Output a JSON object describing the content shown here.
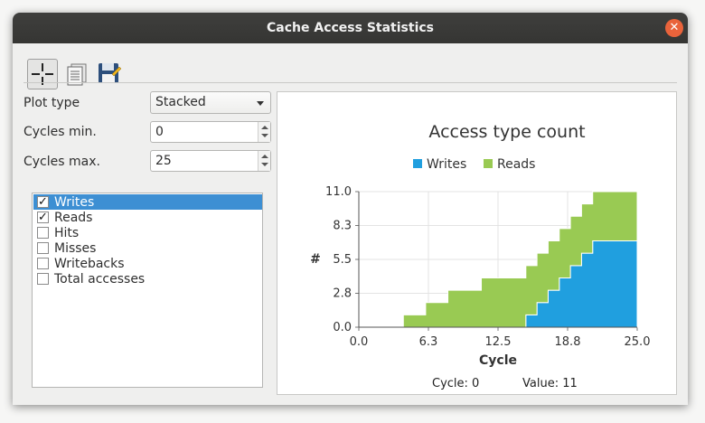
{
  "window": {
    "title": "Cache Access Statistics"
  },
  "toolbar": {
    "buttons": [
      {
        "icon": "crosshair-icon"
      },
      {
        "icon": "document-list-icon"
      },
      {
        "icon": "save-disk-icon"
      }
    ]
  },
  "form": {
    "plot_type_label": "Plot type",
    "plot_type_value": "Stacked",
    "cycles_min_label": "Cycles min.",
    "cycles_min_value": "0",
    "cycles_max_label": "Cycles max.",
    "cycles_max_value": "25"
  },
  "series_list": [
    {
      "label": "Writes",
      "checked": true,
      "selected": true
    },
    {
      "label": "Reads",
      "checked": true,
      "selected": false
    },
    {
      "label": "Hits",
      "checked": false,
      "selected": false
    },
    {
      "label": "Misses",
      "checked": false,
      "selected": false
    },
    {
      "label": "Writebacks",
      "checked": false,
      "selected": false
    },
    {
      "label": "Total accesses",
      "checked": false,
      "selected": false
    }
  ],
  "status": {
    "cycle": "Cycle: 0",
    "value": "Value: 11"
  },
  "colors": {
    "writes": "#209fdf",
    "reads": "#99ca53",
    "selection": "#3d8fd3"
  },
  "chart_data": {
    "type": "area",
    "title": "Access type count",
    "xlabel": "Cycle",
    "ylabel": "#",
    "xlim": [
      0,
      25
    ],
    "ylim": [
      0,
      11
    ],
    "xticks": [
      "0.0",
      "6.3",
      "12.5",
      "18.8",
      "25.0"
    ],
    "yticks": [
      "0.0",
      "2.8",
      "5.5",
      "8.3",
      "11.0"
    ],
    "legend": "top-center",
    "stacked": true,
    "x": [
      4,
      5,
      6,
      7,
      8,
      9,
      10,
      11,
      12,
      13,
      14,
      15,
      16,
      17,
      18,
      19,
      20,
      21,
      22,
      23,
      24,
      25
    ],
    "series": [
      {
        "name": "Writes",
        "color": "#209fdf",
        "values": [
          0,
          0,
          0,
          0,
          0,
          0,
          0,
          0,
          0,
          0,
          0,
          1,
          2,
          3,
          4,
          5,
          6,
          7,
          7,
          7,
          7,
          7
        ]
      },
      {
        "name": "Reads",
        "color": "#99ca53",
        "values": [
          1,
          1,
          2,
          2,
          3,
          3,
          3,
          4,
          4,
          4,
          4,
          4,
          4,
          4,
          4,
          4,
          4,
          4,
          4,
          4,
          4,
          4
        ]
      }
    ]
  }
}
